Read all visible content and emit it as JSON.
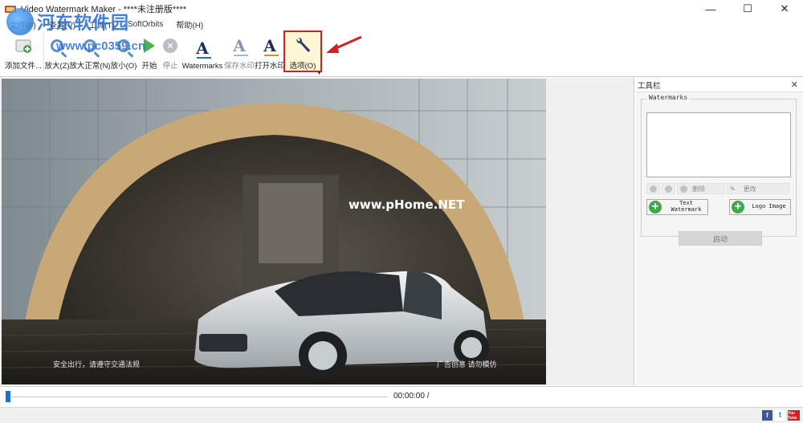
{
  "window": {
    "title": "Video Watermark Maker - ****未注册版****",
    "minimize_glyph": "—",
    "maximize_glyph": "☐",
    "close_glyph": "✕"
  },
  "menu": [
    "文件(F)",
    "查看(V)",
    "工具(T)",
    "SoftOrbits",
    "帮助(H)"
  ],
  "site_watermark": {
    "name": "河东软件园",
    "url": "www.pc0359.cn"
  },
  "toolbar": {
    "add_file": "添加文件...",
    "zoom_in": "放大(Z)",
    "zoom_normal": "放大正常(N)",
    "zoom_out": "放小(O)",
    "start": "开始",
    "stop": "停止",
    "watermarks": "Watermarks",
    "save_watermark": "保存水印",
    "open_watermark": "打开水印",
    "options": "选项(O)"
  },
  "preview": {
    "overlay_text": "www.pHome.NET",
    "caption_left": "安全出行，请遵守交通法规",
    "caption_right": "广告创意 请勿模仿"
  },
  "tool_panel": {
    "title": "工具栏",
    "close_glyph": "✕",
    "watermarks_legend": "Watermarks",
    "delete_label": "删除",
    "change_label": "更改",
    "text_watermark": "Text Watermark",
    "logo_image": "Logo Image",
    "start_button": "启动"
  },
  "timeline": {
    "time": "00:00:00 /",
    "progress": 0
  },
  "status": {
    "social": [
      "f",
      "t",
      "You Tube"
    ]
  }
}
